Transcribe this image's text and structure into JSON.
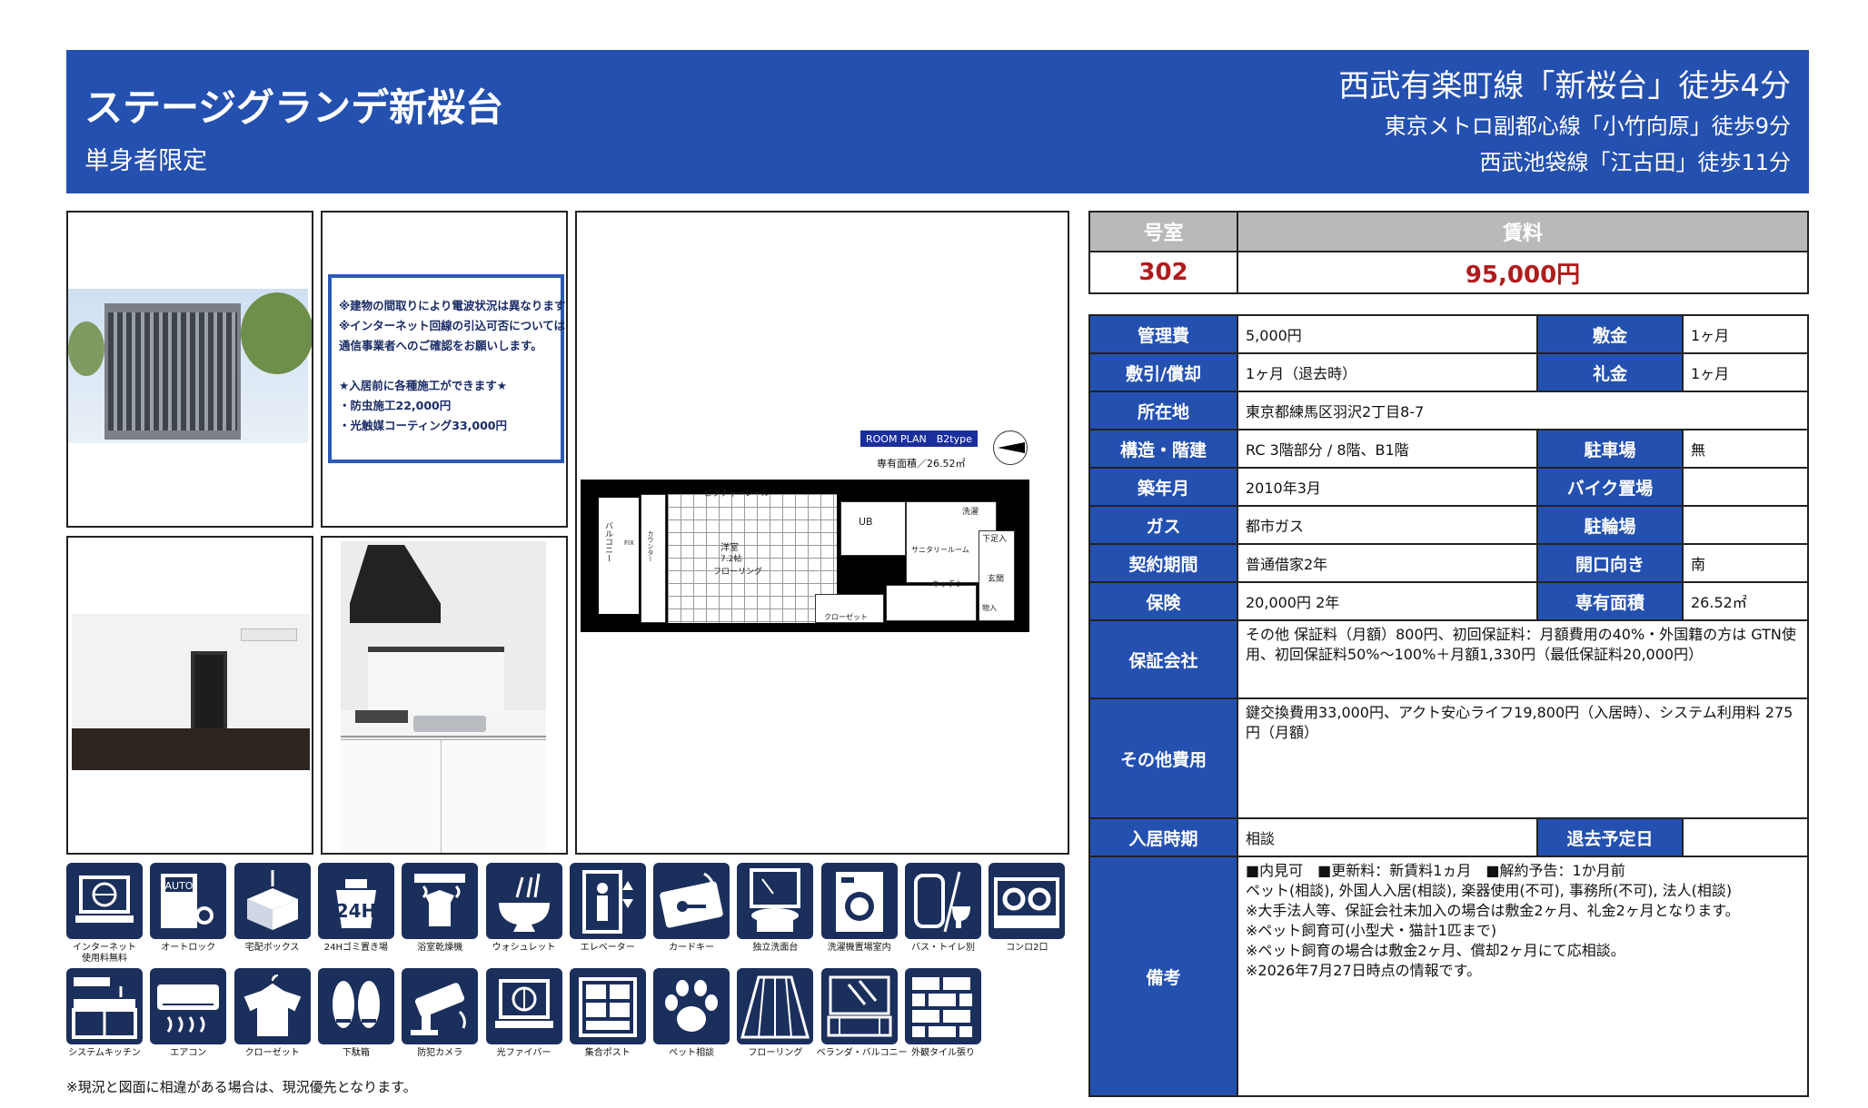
{
  "header": {
    "building_name": "ステージグランデ新桜台",
    "subtitle": "単身者限定",
    "stations": [
      "西武有楽町線「新桜台」徒歩4分",
      "東京メトロ副都心線「小竹向原」徒歩9分",
      "西武池袋線「江古田」徒歩11分"
    ]
  },
  "notice": {
    "lines": [
      "※建物の間取りにより電波状況は異なります",
      "※インターネット回線の引込可否については",
      "通信事業者へのご確認をお願いします。",
      "",
      "★入居前に各種施工ができます★",
      "・防虫施工22,000円",
      "・光触媒コーティング33,000円"
    ]
  },
  "floor_plan": {
    "tag": "ROOM PLAN　B2type",
    "area": "専有面積／26.52㎡",
    "labels": {
      "picture_rail": "ピクチャーレール",
      "room": "洋室",
      "room_size": "7.2帖",
      "flooring": "フローリング",
      "ub": "UB",
      "washer": "洗濯",
      "sanitary": "サニタリールーム",
      "kitchen": "キッチン",
      "closet": "クローゼット",
      "shoebox": "下足入",
      "entrance": "玄関",
      "balcony": "バルコニー",
      "storage": "物入",
      "counter": "カウンター",
      "fix": "FIX"
    }
  },
  "amenities": [
    {
      "icon": "internet-icon",
      "label": "インターネット\n使用料無料"
    },
    {
      "icon": "autolock-icon",
      "label": "オートロック"
    },
    {
      "icon": "delivery-box-icon",
      "label": "宅配ボックス"
    },
    {
      "icon": "garbage-24h-icon",
      "label": "24Hゴミ置き場"
    },
    {
      "icon": "bathroom-dryer-icon",
      "label": "浴室乾燥機"
    },
    {
      "icon": "washlet-icon",
      "label": "ウォシュレット"
    },
    {
      "icon": "elevator-icon",
      "label": "エレベーター"
    },
    {
      "icon": "card-key-icon",
      "label": "カードキー"
    },
    {
      "icon": "vanity-icon",
      "label": "独立洗面台"
    },
    {
      "icon": "washer-space-icon",
      "label": "洗濯機置場室内"
    },
    {
      "icon": "bath-toilet-separate-icon",
      "label": "バス・トイレ別"
    },
    {
      "icon": "two-burner-stove-icon",
      "label": "コンロ2口"
    },
    {
      "icon": "system-kitchen-icon",
      "label": "システムキッチン"
    },
    {
      "icon": "air-conditioner-icon",
      "label": "エアコン"
    },
    {
      "icon": "closet-icon",
      "label": "クローゼット"
    },
    {
      "icon": "shoe-box-icon",
      "label": "下駄箱"
    },
    {
      "icon": "security-camera-icon",
      "label": "防犯カメラ"
    },
    {
      "icon": "fiber-optic-icon",
      "label": "光ファイバー"
    },
    {
      "icon": "mailbox-icon",
      "label": "集合ポスト"
    },
    {
      "icon": "pet-icon",
      "label": "ペット相談"
    },
    {
      "icon": "flooring-icon",
      "label": "フローリング"
    },
    {
      "icon": "veranda-icon",
      "label": "ベランダ・バルコニー"
    },
    {
      "icon": "tile-exterior-icon",
      "label": "外観タイル張り"
    }
  ],
  "disclaimer": "※現況と図面に相違がある場合は、現況優先となります。",
  "room_rent": {
    "room_label": "号室",
    "rent_label": "賃料",
    "room": "302",
    "rent": "95,000円"
  },
  "details": {
    "mgmt_fee_k": "管理費",
    "mgmt_fee": "5,000円",
    "deposit_k": "敷金",
    "deposit": "1ヶ月",
    "shikibiki_k": "敷引/償却",
    "shikibiki": "1ヶ月（退去時）",
    "key_money_k": "礼金",
    "key_money": "1ヶ月",
    "address_k": "所在地",
    "address": "東京都練馬区羽沢2丁目8-7",
    "structure_k": "構造・階建",
    "structure": "RC 3階部分 / 8階、B1階",
    "parking_k": "駐車場",
    "parking": "無",
    "built_k": "築年月",
    "built": "2010年3月",
    "bike_k": "バイク置場",
    "bike": "",
    "gas_k": "ガス",
    "gas": "都市ガス",
    "bicycle_k": "駐輪場",
    "bicycle": "",
    "contract_k": "契約期間",
    "contract": "普通借家2年",
    "facing_k": "開口向き",
    "facing": "南",
    "insurance_k": "保険",
    "insurance": "20,000円 2年",
    "area_k": "専有面積",
    "area": "26.52㎡",
    "guarantor_k": "保証会社",
    "guarantor": "その他 保証料（月額）800円、初回保証料：月額費用の40%・外国籍の方は GTN使用、初回保証料50%～100%＋月額1,330円（最低保証料20,000円）",
    "other_fees_k": "その他費用",
    "other_fees": "鍵交換費用33,000円、アクト安心ライフ19,800円（入居時）、システム利用料 275円（月額）",
    "move_in_k": "入居時期",
    "move_in": "相談",
    "move_out_k": "退去予定日",
    "move_out": "",
    "remarks_k": "備考",
    "remarks": [
      "■内見可　■更新料：新賃料1ヵ月　■解約予告：1か月前",
      "ペット(相談), 外国人入居(相談), 楽器使用(不可), 事務所(不可), 法人(相談)",
      "※大手法人等、保証会社未加入の場合は敷金2ヶ月、礼金2ヶ月となります。",
      "※ペット飼育可(小型犬・猫計1匹まで)",
      "※ペット飼育の場合は敷金2ヶ月、償却2ヶ月にて応相談。",
      "※2026年7月27日時点の情報です。"
    ]
  }
}
